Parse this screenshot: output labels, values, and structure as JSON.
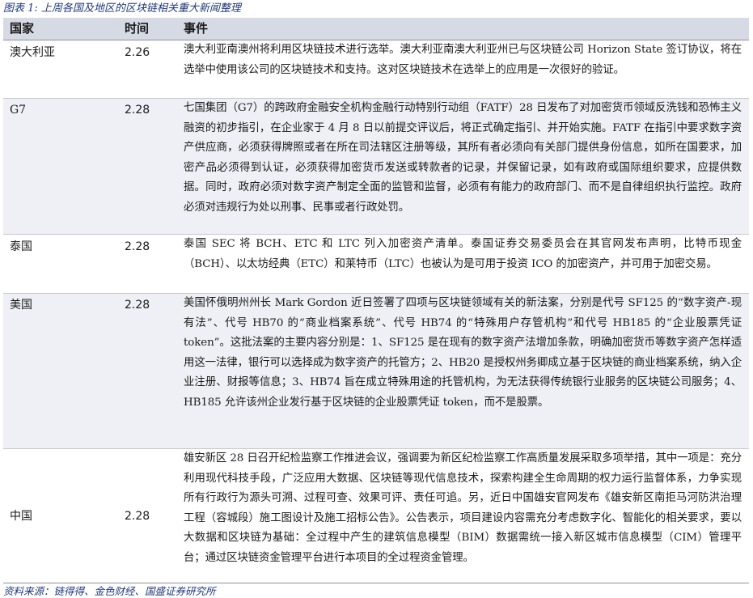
{
  "caption": "图表 1: 上周各国及地区的区块链相关重大新闻整理",
  "headers": {
    "country": "国家",
    "time": "时间",
    "event": "事件"
  },
  "rows": [
    {
      "country": "澳大利亚",
      "time": "2.26",
      "event": "澳大利亚南澳州将利用区块链技术进行选举。澳大利亚南澳大利亚州已与区块链公司 Horizon State 签订协议，将在选举中使用该公司的区块链技术和支持。这对区块链技术在选举上的应用是一次很好的验证。"
    },
    {
      "country": "G7",
      "time": "2.28",
      "event": "七国集团（G7）的跨政府金融安全机构金融行动特别行动组（FATF）28 日发布了对加密货币领域反洗钱和恐怖主义融资的初步指引，在企业家于 4 月 8 日以前提交评议后，将正式确定指引、并开始实施。FATF 在指引中要求数字资产供应商，必须获得牌照或者在所在司法辖区注册等级，其所有者必须向有关部门提供身份信息，如所在国要求，加密产品必须得到认证，必须获得加密货币发送或转款者的记录，并保留记录，如有政府或国际组织要求，应提供数据。同时，政府必须对数字资产制定全面的监管和监督，必须有有能力的政府部门、而不是自律组织执行监控。政府必须对违规行为处以刑事、民事或者行政处罚。"
    },
    {
      "country": "泰国",
      "time": "2.28",
      "event": "泰国 SEC 将 BCH、ETC 和 LTC 列入加密资产清单。泰国证券交易委员会在其官网发布声明，比特币现金（BCH）、以太坊经典（ETC）和莱特币（LTC）也被认为是可用于投资 ICO 的加密资产，并可用于加密交易。"
    },
    {
      "country": "美国",
      "time": "2.28",
      "event": "美国怀俄明州州长 Mark Gordon 近日签署了四项与区块链领域有关的新法案，分别是代号 SF125 的“数字资产-现有法”、代号 HB70 的“商业档案系统”、代号 HB74 的“特殊用户存管机构”和代号 HB185 的“企业股票凭证 token”。这批法案的主要内容分别是：1、SF125 是在现有的数字资产法增加条款，明确加密货币等数字资产怎样适用这一法律，银行可以选择成为数字资产的托管方；2、HB20 是授权州务卿成立基于区块链的商业档案系统，纳入企业注册、财报等信息；3、HB74 旨在成立特殊用途的托管机构，为无法获得传统银行业服务的区块链公司服务；4、HB185 允许该州企业发行基于区块链的企业股票凭证 token，而不是股票。"
    },
    {
      "country": "中国",
      "time": "2.28",
      "event": "雄安新区 28 日召开纪检监察工作推进会议，强调要为新区纪检监察工作高质量发展采取多项举措，其中一项是：充分利用现代科技手段，广泛应用大数据、区块链等现代信息技术，探索构建全生命周期的权力运行监督体系，力争实现所有行政行为源头可溯、过程可查、效果可评、责任可追。另，近日中国雄安官网发布《雄安新区南拒马河防洪治理工程（容城段）施工图设计及施工招标公告》。公告表示，项目建设内容需充分考虑数字化、智能化的相关要求，要以大数据和区块链为基础：全过程中产生的建筑信息模型（BIM）数据需统一接入新区城市信息模型（CIM）管理平台；通过区块链资金管理平台进行本项目的全过程资金管理。"
    }
  ],
  "source": "资料来源：链得得、金色财经、国盛证券研究所"
}
